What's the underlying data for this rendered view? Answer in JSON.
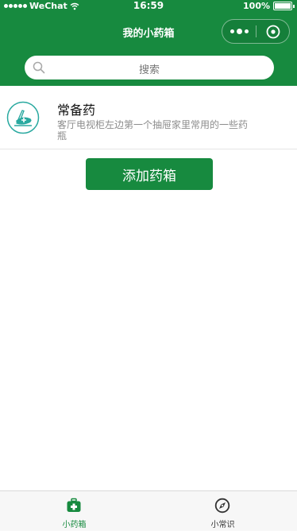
{
  "status_bar": {
    "carrier": "WeChat",
    "time": "16:59",
    "battery": "100%"
  },
  "nav": {
    "title": "我的小药箱"
  },
  "search": {
    "placeholder": "搜索"
  },
  "kits": [
    {
      "name": "常备药",
      "description": "客厅电视柜左边第一个抽屉家里常用的一些药瓶",
      "icon": "medicine-kit-icon"
    }
  ],
  "add_button": {
    "label": "添加药箱"
  },
  "tabbar": {
    "tabs": [
      {
        "label": "小药箱",
        "icon": "medicine-box-icon",
        "active": true
      },
      {
        "label": "小常识",
        "icon": "compass-icon",
        "active": false
      }
    ]
  },
  "colors": {
    "brand": "#178a3f",
    "tab_inactive": "#333333",
    "muted": "#8c8c8c",
    "kit_icon": "#2aa9a0"
  }
}
